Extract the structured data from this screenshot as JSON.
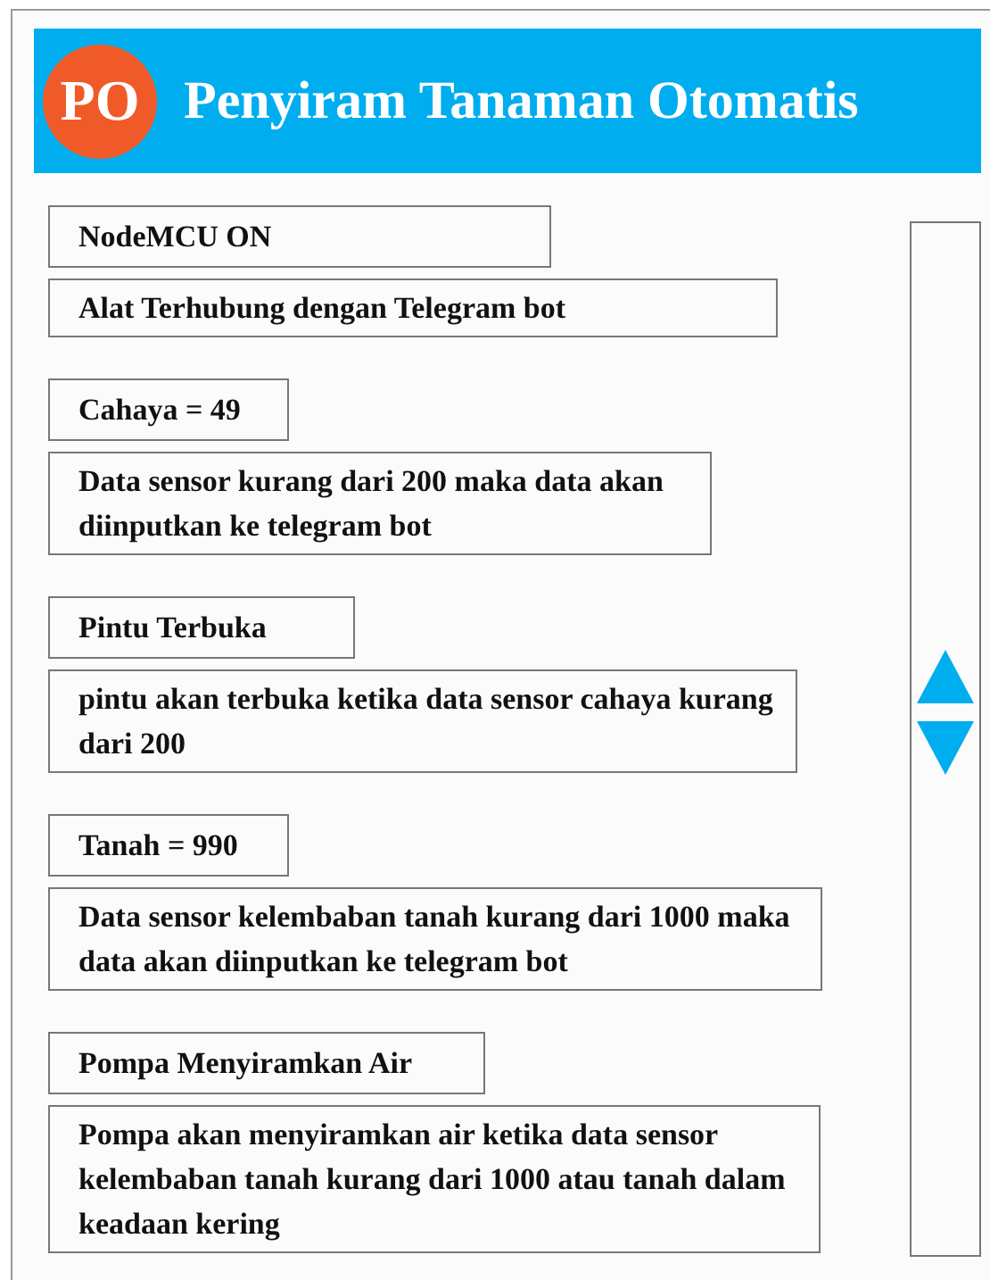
{
  "header": {
    "logo": "PO",
    "title": "Penyiram Tanaman Otomatis"
  },
  "items": [
    {
      "label": "NodeMCU ON",
      "description": "Alat Terhubung dengan Telegram bot"
    },
    {
      "label": "Cahaya = 49",
      "description": "Data sensor kurang dari 200 maka data akan diinputkan ke telegram bot"
    },
    {
      "label": "Pintu Terbuka",
      "description": "pintu akan terbuka ketika data sensor cahaya kurang dari 200"
    },
    {
      "label": "Tanah = 990",
      "description": "Data sensor kelembaban tanah kurang dari 1000 maka data akan diinputkan ke telegram bot"
    },
    {
      "label": "Pompa Menyiramkan Air",
      "description": "Pompa akan menyiramkan air ketika data sensor kelembaban tanah kurang dari 1000 atau tanah dalam keadaan kering"
    }
  ]
}
